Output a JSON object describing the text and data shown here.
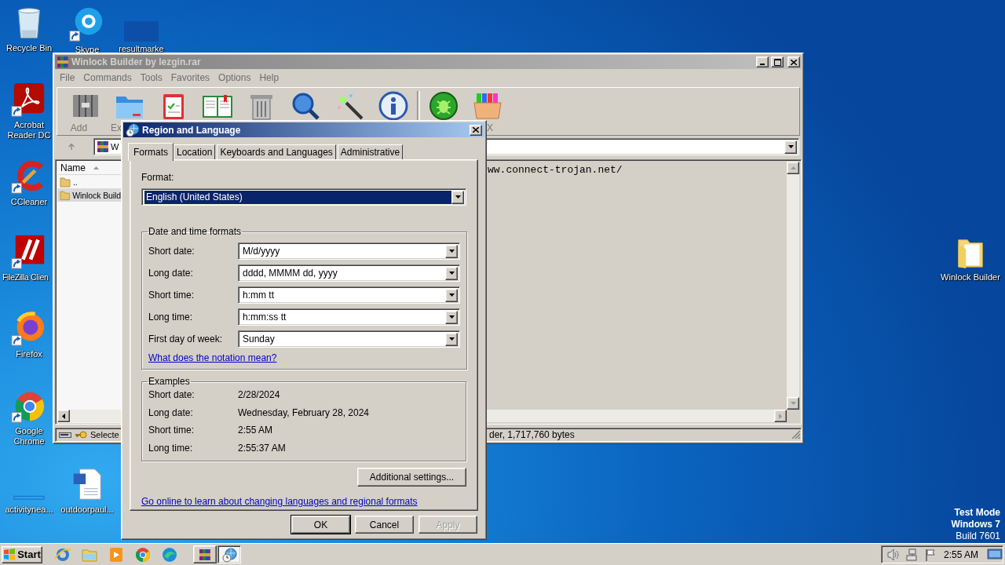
{
  "desktop": {
    "icons": [
      {
        "label": "Recycle Bin"
      },
      {
        "label": "Skype"
      },
      {
        "label": "resultmarke"
      },
      {
        "label": "Acrobat Reader DC"
      },
      {
        "label": "CCleaner"
      },
      {
        "label": "FileZilla Clien"
      },
      {
        "label": "Firefox"
      },
      {
        "label": "Google Chrome"
      },
      {
        "label": "activitynea..."
      },
      {
        "label": "outdoorpaul..."
      },
      {
        "label": "Winlock Builder"
      }
    ],
    "os_notice": [
      "Test Mode",
      "Windows 7",
      "Build 7601"
    ]
  },
  "winrar": {
    "title": "Winlock Builder by lezgin.rar",
    "active": false,
    "menu": [
      "File",
      "Commands",
      "Tools",
      "Favorites",
      "Options",
      "Help"
    ],
    "toolbar": [
      {
        "kind": "button",
        "label": "Add"
      },
      {
        "kind": "button",
        "label": "Ex"
      },
      {
        "kind": "button"
      },
      {
        "kind": "button"
      },
      {
        "kind": "button"
      },
      {
        "kind": "button"
      },
      {
        "kind": "button"
      },
      {
        "kind": "button"
      },
      {
        "kind": "separator"
      },
      {
        "kind": "button"
      },
      {
        "kind": "button",
        "label": "X"
      }
    ],
    "address": {
      "value": "W"
    },
    "list": {
      "columns": [
        {
          "label": "Name",
          "sort_ascending": true
        }
      ],
      "rows": [
        {
          "name": "..",
          "selected": false
        },
        {
          "name": "Winlock Build",
          "selected": true
        }
      ]
    },
    "comment": "ww.connect-trojan.net/",
    "status": {
      "left": "Selecte",
      "right": "der, 1,717,760 bytes"
    }
  },
  "dialog": {
    "title": "Region and Language",
    "active": true,
    "tabs": [
      {
        "label": "Formats",
        "selected": true
      },
      {
        "label": "Location",
        "selected": false
      },
      {
        "label": "Keyboards and Languages",
        "selected": false
      },
      {
        "label": "Administrative",
        "selected": false
      }
    ],
    "format": {
      "label": "Format:",
      "value": "English (United States)",
      "focused": true
    },
    "date_time_group": {
      "title": "Date and time formats",
      "rows": [
        {
          "label": "Short date:",
          "value": "M/d/yyyy"
        },
        {
          "label": "Long date:",
          "value": "dddd, MMMM dd, yyyy"
        },
        {
          "label": "Short time:",
          "value": "h:mm tt"
        },
        {
          "label": "Long time:",
          "value": "h:mm:ss tt"
        },
        {
          "label": "First day of week:",
          "value": "Sunday"
        }
      ],
      "link": "What does the notation mean?"
    },
    "examples": {
      "title": "Examples",
      "rows": [
        {
          "label": "Short date:",
          "value": "2/28/2024"
        },
        {
          "label": "Long date:",
          "value": "Wednesday, February 28, 2024"
        },
        {
          "label": "Short time:",
          "value": "2:55 AM"
        },
        {
          "label": "Long time:",
          "value": "2:55:37 AM"
        }
      ]
    },
    "additional_button": "Additional settings...",
    "online_link": "Go online to learn about changing languages and regional formats",
    "buttons": [
      {
        "label": "OK",
        "default": true,
        "disabled": false
      },
      {
        "label": "Cancel",
        "default": false,
        "disabled": false
      },
      {
        "label": "Apply",
        "default": false,
        "disabled": true
      }
    ]
  },
  "taskbar": {
    "start": "Start",
    "items": [
      {
        "kind": "pinned",
        "selected": false
      },
      {
        "kind": "pinned",
        "selected": false
      },
      {
        "kind": "pinned",
        "selected": false
      },
      {
        "kind": "pinned",
        "selected": false
      },
      {
        "kind": "pinned",
        "selected": false
      },
      {
        "kind": "window",
        "selected": false
      },
      {
        "kind": "window",
        "selected": true
      }
    ],
    "clock": "2:55 AM"
  }
}
